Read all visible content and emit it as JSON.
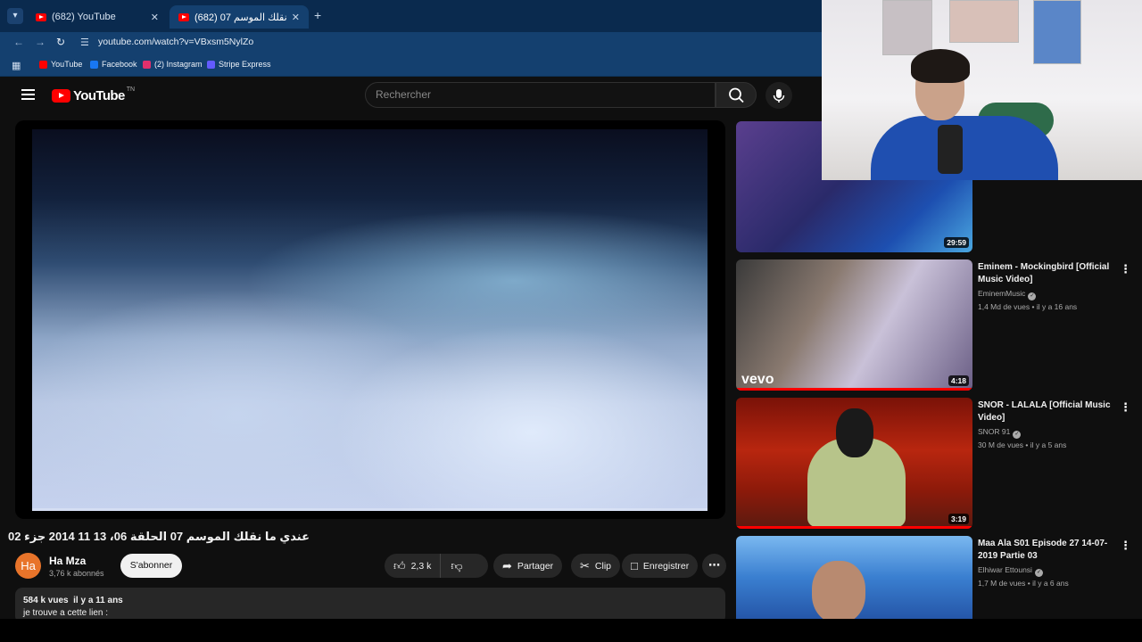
{
  "browser": {
    "tabs": [
      {
        "title": "(682) YouTube",
        "active": false
      },
      {
        "title": "(682) عندي ما نقلك الموسم 07 ...",
        "active": true
      }
    ],
    "url": "youtube.com/watch?v=VBxsm5NylZo",
    "bookmarks": [
      {
        "label": "YouTube",
        "color": "#ff0000"
      },
      {
        "label": "Facebook",
        "color": "#1877f2"
      },
      {
        "label": "(2) Instagram",
        "color": "#e1306c"
      },
      {
        "label": "Stripe Express",
        "color": "#635bff"
      }
    ]
  },
  "header": {
    "logo_text": "YouTube",
    "logo_sup": "TN",
    "search_placeholder": "Rechercher"
  },
  "video": {
    "title": "عندي ما نقلك الموسم 07 الحلقة 06، 13 11 2014 جزء 02",
    "channel": "Ha Mza",
    "avatar_text": "Ha",
    "subscribers": "3,76 k abonnés",
    "subscribe_label": "S'abonner",
    "likes": "2,3 k",
    "share_label": "Partager",
    "clip_label": "Clip",
    "save_label": "Enregistrer",
    "description_meta": "584 k vues  il y a 11 ans",
    "description_text": "je trouve a cette lien :"
  },
  "recommendations": [
    {
      "title": "",
      "channel": "",
      "stats": "",
      "duration": "29:59",
      "thumb_color": "#2a2a6a"
    },
    {
      "title": "Eminem - Mockingbird [Official Music Video]",
      "channel": "EminemMusic",
      "stats": "1,4 Md de vues • il y a 16 ans",
      "duration": "4:18",
      "thumb_color": "#6a6a7a",
      "watermark": "vevo"
    },
    {
      "title": "SNOR - LALALA [Official Music Video]",
      "channel": "SNOR 91",
      "stats": "30 M de vues • il y a 5 ans",
      "duration": "3:19",
      "thumb_color": "#a02010"
    },
    {
      "title": "Maa Ala S01 Episode 27 14-07-2019 Partie 03",
      "channel": "Elhiwar Ettounsi",
      "stats": "1,7 M de vues • il y a 6 ans",
      "duration": "",
      "thumb_color": "#3a7fd0"
    }
  ]
}
